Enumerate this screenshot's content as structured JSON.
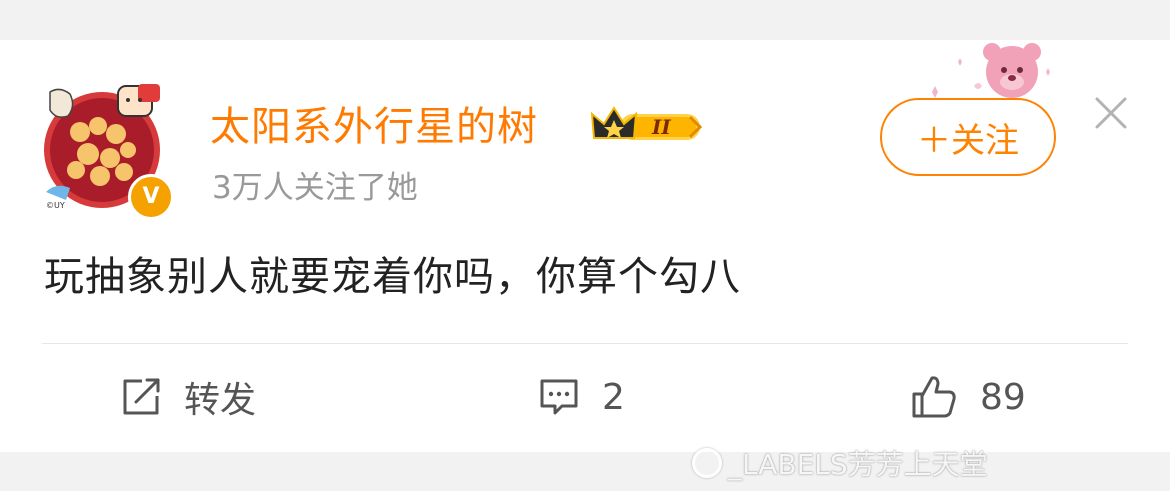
{
  "post": {
    "author": "太阳系外行星的树",
    "followers_text": "3万人关注了她",
    "membership_level": "II",
    "vip_mark": "V",
    "follow_label": "＋关注",
    "content": "玩抽象别人就要宠着你吗，你算个勾八"
  },
  "actions": {
    "repost_label": "转发",
    "comment_count": "2",
    "like_count": "89"
  },
  "icons": {
    "repost": "edit-share-icon",
    "comment": "comment-bubble-icon",
    "like": "thumbs-up-icon",
    "close": "close-icon",
    "crown": "crown-icon"
  },
  "watermark": "_LABELS芳芳上天堂",
  "colors": {
    "accent": "#ff8200",
    "username": "#ff7a00",
    "text": "#222222",
    "muted": "#999999",
    "background": "#f2f2f2"
  }
}
